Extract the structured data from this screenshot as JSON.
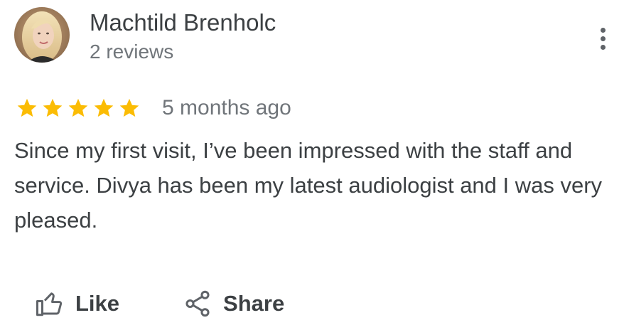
{
  "review": {
    "author_name": "Machtild Brenholc",
    "review_count": "2 reviews",
    "rating": 5,
    "rating_max": 5,
    "star_color": "#fbbc04",
    "timestamp": "5 months ago",
    "text": "Since my first visit, I’ve been impressed with the staff and service. Divya has been my latest audiologist and I was very pleased."
  },
  "menu": {
    "icon": "more-vert-icon"
  },
  "actions": {
    "like_label": "Like",
    "like_icon": "thumbs-up-icon",
    "share_label": "Share",
    "share_icon": "share-icon"
  }
}
